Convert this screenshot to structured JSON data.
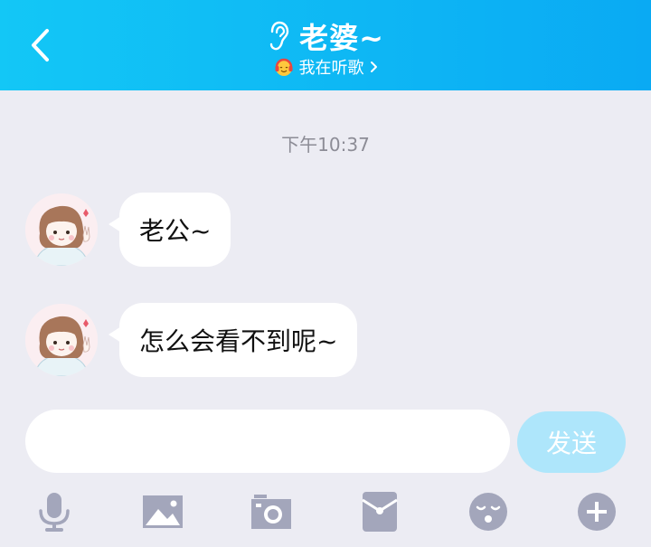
{
  "header": {
    "title": "老婆~",
    "status": "我在听歌",
    "icons": {
      "back": "chevron-left-icon",
      "title": "ear-icon",
      "status": "music-emoji-icon",
      "status_arrow": "chevron-right-icon"
    },
    "gradient_colors": [
      "#13c7f6",
      "#0aaaf3"
    ]
  },
  "chat": {
    "timestamp": "下午10:37",
    "messages": [
      {
        "sender": "other",
        "text": "老公~"
      },
      {
        "sender": "other",
        "text": "怎么会看不到呢~"
      }
    ]
  },
  "composer": {
    "input_value": "",
    "send_label": "发送",
    "send_color": "#aee6fb"
  },
  "toolbar": {
    "icons": [
      "microphone-icon",
      "image-icon",
      "camera-icon",
      "red-packet-icon",
      "emoji-icon",
      "plus-icon"
    ],
    "icon_color": "#a3a6bb"
  }
}
